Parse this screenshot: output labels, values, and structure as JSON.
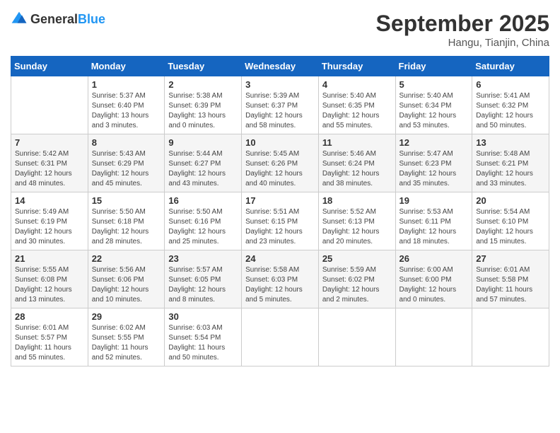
{
  "header": {
    "logo": {
      "general": "General",
      "blue": "Blue"
    },
    "title": "September 2025",
    "location": "Hangu, Tianjin, China"
  },
  "weekdays": [
    "Sunday",
    "Monday",
    "Tuesday",
    "Wednesday",
    "Thursday",
    "Friday",
    "Saturday"
  ],
  "weeks": [
    [
      {
        "day": "",
        "empty": true
      },
      {
        "day": "1",
        "sunrise": "5:37 AM",
        "sunset": "6:40 PM",
        "daylight": "13 hours and 3 minutes."
      },
      {
        "day": "2",
        "sunrise": "5:38 AM",
        "sunset": "6:39 PM",
        "daylight": "13 hours and 0 minutes."
      },
      {
        "day": "3",
        "sunrise": "5:39 AM",
        "sunset": "6:37 PM",
        "daylight": "12 hours and 58 minutes."
      },
      {
        "day": "4",
        "sunrise": "5:40 AM",
        "sunset": "6:35 PM",
        "daylight": "12 hours and 55 minutes."
      },
      {
        "day": "5",
        "sunrise": "5:40 AM",
        "sunset": "6:34 PM",
        "daylight": "12 hours and 53 minutes."
      },
      {
        "day": "6",
        "sunrise": "5:41 AM",
        "sunset": "6:32 PM",
        "daylight": "12 hours and 50 minutes."
      }
    ],
    [
      {
        "day": "7",
        "sunrise": "5:42 AM",
        "sunset": "6:31 PM",
        "daylight": "12 hours and 48 minutes."
      },
      {
        "day": "8",
        "sunrise": "5:43 AM",
        "sunset": "6:29 PM",
        "daylight": "12 hours and 45 minutes."
      },
      {
        "day": "9",
        "sunrise": "5:44 AM",
        "sunset": "6:27 PM",
        "daylight": "12 hours and 43 minutes."
      },
      {
        "day": "10",
        "sunrise": "5:45 AM",
        "sunset": "6:26 PM",
        "daylight": "12 hours and 40 minutes."
      },
      {
        "day": "11",
        "sunrise": "5:46 AM",
        "sunset": "6:24 PM",
        "daylight": "12 hours and 38 minutes."
      },
      {
        "day": "12",
        "sunrise": "5:47 AM",
        "sunset": "6:23 PM",
        "daylight": "12 hours and 35 minutes."
      },
      {
        "day": "13",
        "sunrise": "5:48 AM",
        "sunset": "6:21 PM",
        "daylight": "12 hours and 33 minutes."
      }
    ],
    [
      {
        "day": "14",
        "sunrise": "5:49 AM",
        "sunset": "6:19 PM",
        "daylight": "12 hours and 30 minutes."
      },
      {
        "day": "15",
        "sunrise": "5:50 AM",
        "sunset": "6:18 PM",
        "daylight": "12 hours and 28 minutes."
      },
      {
        "day": "16",
        "sunrise": "5:50 AM",
        "sunset": "6:16 PM",
        "daylight": "12 hours and 25 minutes."
      },
      {
        "day": "17",
        "sunrise": "5:51 AM",
        "sunset": "6:15 PM",
        "daylight": "12 hours and 23 minutes."
      },
      {
        "day": "18",
        "sunrise": "5:52 AM",
        "sunset": "6:13 PM",
        "daylight": "12 hours and 20 minutes."
      },
      {
        "day": "19",
        "sunrise": "5:53 AM",
        "sunset": "6:11 PM",
        "daylight": "12 hours and 18 minutes."
      },
      {
        "day": "20",
        "sunrise": "5:54 AM",
        "sunset": "6:10 PM",
        "daylight": "12 hours and 15 minutes."
      }
    ],
    [
      {
        "day": "21",
        "sunrise": "5:55 AM",
        "sunset": "6:08 PM",
        "daylight": "12 hours and 13 minutes."
      },
      {
        "day": "22",
        "sunrise": "5:56 AM",
        "sunset": "6:06 PM",
        "daylight": "12 hours and 10 minutes."
      },
      {
        "day": "23",
        "sunrise": "5:57 AM",
        "sunset": "6:05 PM",
        "daylight": "12 hours and 8 minutes."
      },
      {
        "day": "24",
        "sunrise": "5:58 AM",
        "sunset": "6:03 PM",
        "daylight": "12 hours and 5 minutes."
      },
      {
        "day": "25",
        "sunrise": "5:59 AM",
        "sunset": "6:02 PM",
        "daylight": "12 hours and 2 minutes."
      },
      {
        "day": "26",
        "sunrise": "6:00 AM",
        "sunset": "6:00 PM",
        "daylight": "12 hours and 0 minutes."
      },
      {
        "day": "27",
        "sunrise": "6:01 AM",
        "sunset": "5:58 PM",
        "daylight": "11 hours and 57 minutes."
      }
    ],
    [
      {
        "day": "28",
        "sunrise": "6:01 AM",
        "sunset": "5:57 PM",
        "daylight": "11 hours and 55 minutes."
      },
      {
        "day": "29",
        "sunrise": "6:02 AM",
        "sunset": "5:55 PM",
        "daylight": "11 hours and 52 minutes."
      },
      {
        "day": "30",
        "sunrise": "6:03 AM",
        "sunset": "5:54 PM",
        "daylight": "11 hours and 50 minutes."
      },
      {
        "day": "",
        "empty": true
      },
      {
        "day": "",
        "empty": true
      },
      {
        "day": "",
        "empty": true
      },
      {
        "day": "",
        "empty": true
      }
    ]
  ]
}
